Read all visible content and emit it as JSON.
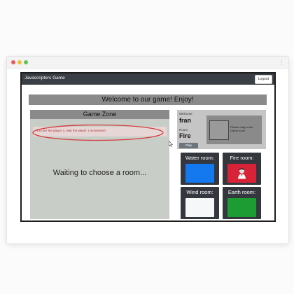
{
  "app": {
    "brand": "Javascripters Game",
    "logout_label": "Logout"
  },
  "banner": {
    "text": "Welcome to our game! Enjoy!"
  },
  "game_zone": {
    "title": "Game Zone",
    "message": "You are the player 2, wait the player 1 movement!",
    "waiting": "Waiting to choose a room..."
  },
  "player": {
    "welcome_label": "Welcome",
    "name": "fran",
    "room_label": "Room",
    "room": "Fire",
    "play_label": "Play",
    "drag_hint": "Please drag to the Game room"
  },
  "rooms": [
    {
      "title": "Water room:",
      "color": "#1478ef"
    },
    {
      "title": "Fire room:",
      "color": "#d82237",
      "icon": "player-avatar-icon"
    },
    {
      "title": "Wind room:",
      "color": "#f6f7f9"
    },
    {
      "title": "Earth room:",
      "color": "#1e9c34"
    }
  ],
  "colors": {
    "navbar": "#3a3f45",
    "header": "#8a8a8a",
    "game_zone_bg": "#c9cdc7",
    "message_text": "#b23636",
    "message_highlight": "#d33b3b",
    "room_card": "#34383e"
  }
}
